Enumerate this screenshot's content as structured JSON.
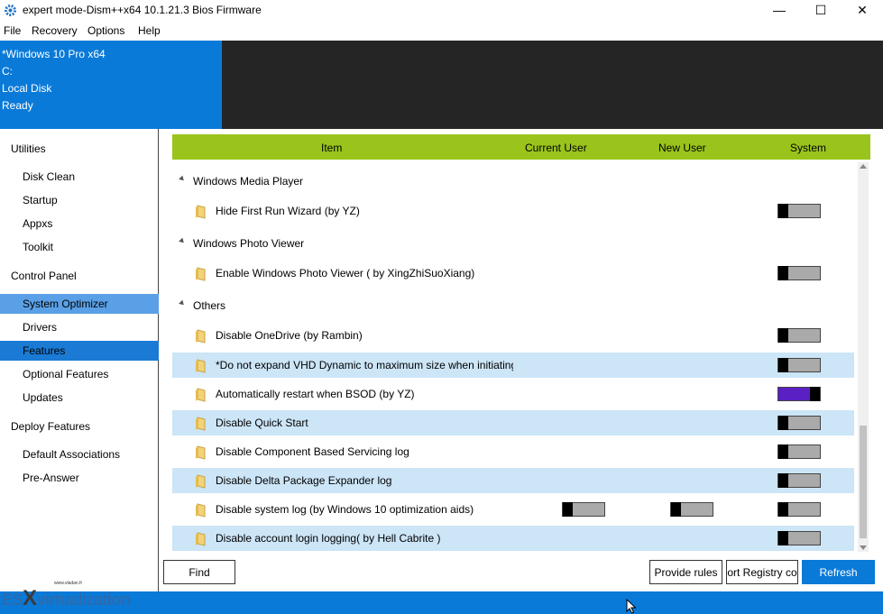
{
  "window": {
    "title": "expert mode-Dism++x64 10.1.21.3 Bios Firmware",
    "minimize": "—",
    "maximize": "☐",
    "close": "✕"
  },
  "menu": [
    "File",
    "Recovery",
    "Options",
    "Help"
  ],
  "info": {
    "os": "*Windows 10 Pro x64",
    "drive": "C:",
    "disk": "Local Disk",
    "status": "Ready"
  },
  "sidebar": {
    "utilities": "Utilities",
    "disk_clean": "Disk Clean",
    "startup": "Startup",
    "appxs": "Appxs",
    "toolkit": "Toolkit",
    "control_panel": "Control Panel",
    "system_optimizer": "System Optimizer",
    "drivers": "Drivers",
    "features": "Features",
    "optional_features": "Optional Features",
    "updates": "Updates",
    "deploy_features": "Deploy Features",
    "default_associations": "Default Associations",
    "pre_answer": "Pre-Answer"
  },
  "table": {
    "headers": {
      "item": "Item",
      "current_user": "Current User",
      "new_user": "New User",
      "system": "System"
    },
    "groups": [
      {
        "label": "Windows Media Player"
      },
      {
        "label": "Windows Photo Viewer"
      },
      {
        "label": "Others"
      }
    ],
    "rows": [
      {
        "label": "Hide First Run Wizard (by YZ)",
        "system": "off"
      },
      {
        "label": "Enable Windows Photo Viewer ( by XingZhiSuoXiang)",
        "system": "off"
      },
      {
        "label": "Disable OneDrive (by Rambin)",
        "system": "off"
      },
      {
        "label": "*Do not expand VHD Dynamic to maximum size when initiating",
        "system": "off"
      },
      {
        "label": "Automatically restart when BSOD (by YZ)",
        "system": "on"
      },
      {
        "label": "Disable Quick Start",
        "system": "off"
      },
      {
        "label": "Disable Component Based Servicing log",
        "system": "off"
      },
      {
        "label": "Disable Delta Package Expander log",
        "system": "off"
      },
      {
        "label": "Disable system log (by Windows 10 optimization aids)",
        "current_user": "off",
        "new_user": "off",
        "system": "off"
      },
      {
        "label": "Disable account login logging( by Hell Cabrite )",
        "system": "off"
      }
    ],
    "toggle_on_color": "#5b20c4"
  },
  "buttons": {
    "find": "Find",
    "provide_rules": "Provide rules",
    "export_registry": "ort Registry co",
    "refresh": "Refresh"
  },
  "watermark": {
    "site": "www.vladan.fr",
    "brand_prefix": "ES",
    "brand_x": "X",
    "brand_suffix": "virtualization"
  },
  "colors": {
    "accent_blue": "#0a7ad8",
    "header_green": "#9ac41c",
    "selected_light": "#5aa0e6",
    "row_alt": "#cce5f7"
  }
}
